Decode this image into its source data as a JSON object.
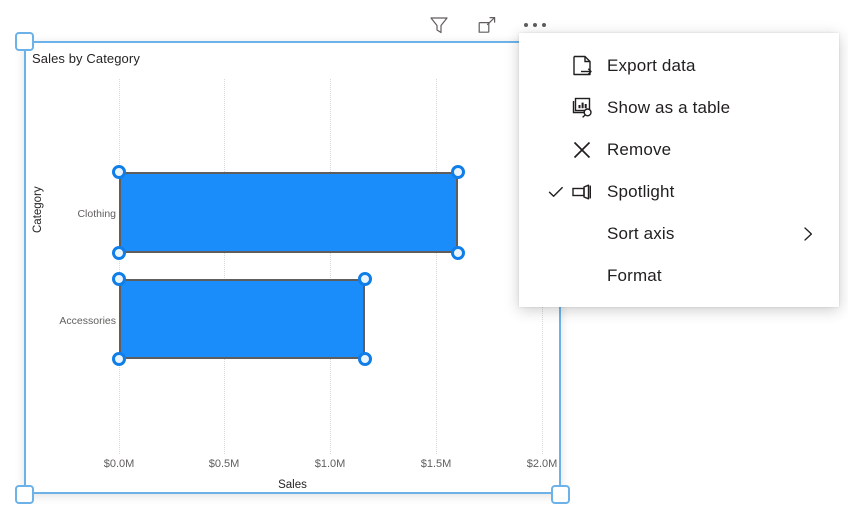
{
  "toolbar": {
    "items": [
      {
        "name": "filter-icon",
        "label": "Filters"
      },
      {
        "name": "focus-mode-icon",
        "label": "Focus mode"
      },
      {
        "name": "more-options-icon",
        "label": "More options"
      }
    ]
  },
  "visual": {
    "title": "Sales by Category",
    "selected": true
  },
  "context_menu": {
    "items": [
      {
        "label": "Export data",
        "icon": "export-data-icon",
        "checked": false,
        "submenu": false
      },
      {
        "label": "Show as a table",
        "icon": "show-as-table-icon",
        "checked": false,
        "submenu": false
      },
      {
        "label": "Remove",
        "icon": "remove-icon",
        "checked": false,
        "submenu": false
      },
      {
        "label": "Spotlight",
        "icon": "spotlight-icon",
        "checked": true,
        "submenu": false
      },
      {
        "label": "Sort axis",
        "icon": "",
        "checked": false,
        "submenu": true
      },
      {
        "label": "Format",
        "icon": "",
        "checked": false,
        "submenu": false
      }
    ]
  },
  "chart_data": {
    "type": "bar",
    "orientation": "horizontal",
    "title": "Sales by Category",
    "xlabel": "Sales",
    "ylabel": "Category",
    "categories": [
      "Clothing",
      "Accessories"
    ],
    "values": [
      1.6,
      1.16
    ],
    "value_unit": "$M",
    "xlim": [
      0,
      2.0
    ],
    "xticks": [
      0,
      0.5,
      1.0,
      1.5,
      2.0
    ],
    "xticklabels": [
      "$0.0M",
      "$0.5M",
      "$1.0M",
      "$1.5M",
      "$2.0M"
    ],
    "grid": true,
    "legend": "none",
    "bar_color": "#1A8DFA",
    "selection_outline_color": "#605e5c",
    "handle_color": "#0f7ee8",
    "series": [
      {
        "name": "Sales",
        "values": [
          1.6,
          1.16
        ]
      }
    ]
  },
  "colors": {
    "accent": "#6cb2e8",
    "bar": "#1A8DFA",
    "text": "#252423",
    "muted": "#605e5c"
  }
}
